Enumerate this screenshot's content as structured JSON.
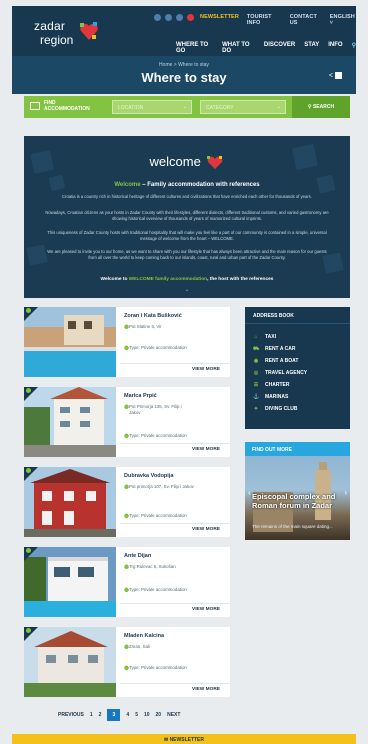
{
  "header": {
    "logo_line1": "zadar",
    "logo_line2": "region",
    "top_nav": [
      "NEWSLETTER",
      "TOURIST INFO",
      "CONTACT US",
      "ENGLISH ˅"
    ],
    "main_nav": [
      "WHERE TO GO",
      "WHAT TO DO",
      "DISCOVER",
      "STAY",
      "INFO"
    ],
    "search_icon": "search-icon",
    "social_icons": [
      "facebook-icon",
      "twitter-icon",
      "instagram-icon",
      "youtube-icon"
    ]
  },
  "hero": {
    "breadcrumb": "Home > Where to stay",
    "title": "Where to stay",
    "share_label": "<"
  },
  "search": {
    "find_label_1": "FIND",
    "find_label_2": "ACCOMMODATION",
    "location_placeholder": "LOCATION",
    "category_placeholder": "CATEGORY",
    "search_button": "SEARCH"
  },
  "welcome": {
    "logo_text": "welcome",
    "heading_green": "Welcome",
    "heading_rest": " – Family accommodation with references",
    "p1": "Croatia is a country rich in historical heritage of different cultures and civilizations that have enriched each other for thousands of years.",
    "p2": "Nowadays, Croatian citizens as your hosts in Zadar County with their lifestyles, different dialects, different traditional customs, and varied gastronomy are showing historical overview of thousands of years of mamorized cultural imprints.",
    "p3": "This uniqueness of Zadar County hosts with traditional hospitality that will make you feel like a part of our community is contained in a simple, universal message of welcome from the heart – WELCOME.",
    "p4": "We are pleased to invite you to our home, as we want to share with you our lifestyle that has always been attractive and the main reason for our guests from all over the world to keep coming back to our islands, coast, rural and urban part of the Zadar County.",
    "footer_pre": "Welcome to ",
    "footer_green": "WELCOME family accommodation",
    "footer_post": ", the host with the references",
    "chevron": "⌄"
  },
  "listings": [
    {
      "name": "Zoran i Kata Bušković",
      "addr": "Put Slatine 5, Vir",
      "type": "Type: Private accommodation",
      "view": "VIEW MORE"
    },
    {
      "name": "Marica Prpić",
      "addr": "Put Primorja 135, Sv. Filip i Jakov",
      "type": "Type: Private accommodation",
      "view": "VIEW MORE"
    },
    {
      "name": "Dubravka Vodopija",
      "addr": "Put primorja 107, Sv. Filip i Jakov",
      "type": "Type: Private accommodation",
      "view": "VIEW MORE"
    },
    {
      "name": "Ante Dijan",
      "addr": "Trg Rulevac 6, Sukošan",
      "type": "Type: Private accommodation",
      "view": "VIEW MORE"
    },
    {
      "name": "Mladen Kalcina",
      "addr": "Zman, Sali",
      "type": "Type: Private accommodation",
      "view": "VIEW MORE"
    }
  ],
  "address_book": {
    "title": "ADDRESS BOOK",
    "items": [
      "TAXI",
      "RENT A CAR",
      "RENT A BOAT",
      "TRAVEL AGENCY",
      "CHARTER",
      "MARINAS",
      "DIVING CLUB"
    ]
  },
  "find_out_more": {
    "title": "FIND OUT MORE",
    "caption": "Episcopal complex and Roman forum in Zadar",
    "sub": "The remains of the main square dating..."
  },
  "pagination": {
    "prev": "PREVIOUS",
    "pages": [
      "1",
      "2",
      "3",
      "4",
      "5",
      "10",
      "20"
    ],
    "current": "3",
    "next": "NEXT"
  },
  "newsletter_bar": "NEWSLETTER",
  "colors": {
    "navy": "#17384f",
    "green": "#82c341",
    "yellow": "#f3c21a",
    "blue": "#1778bf"
  }
}
